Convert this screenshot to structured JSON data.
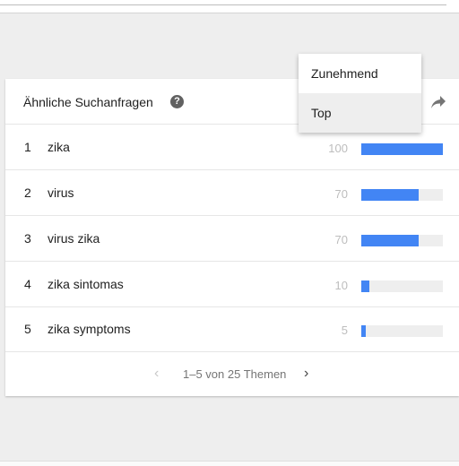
{
  "panel": {
    "title": "Ähnliche Suchanfragen",
    "help_glyph": "?"
  },
  "rows": [
    {
      "rank": "1",
      "term": "zika",
      "value": "100",
      "fraction": 1.0
    },
    {
      "rank": "2",
      "term": "virus",
      "value": "70",
      "fraction": 0.7
    },
    {
      "rank": "3",
      "term": "virus zika",
      "value": "70",
      "fraction": 0.7
    },
    {
      "rank": "4",
      "term": "zika sintomas",
      "value": "10",
      "fraction": 0.1
    },
    {
      "rank": "5",
      "term": "zika symptoms",
      "value": "5",
      "fraction": 0.05
    }
  ],
  "pagination": {
    "prev_glyph": "‹",
    "label": "1–5 von 25 Themen",
    "next_glyph": "›"
  },
  "dropdown": {
    "options": [
      "Zunehmend",
      "Top"
    ],
    "selected": "Top"
  },
  "colors": {
    "bar": "#4285f4",
    "bar_track": "#eeeeee"
  }
}
